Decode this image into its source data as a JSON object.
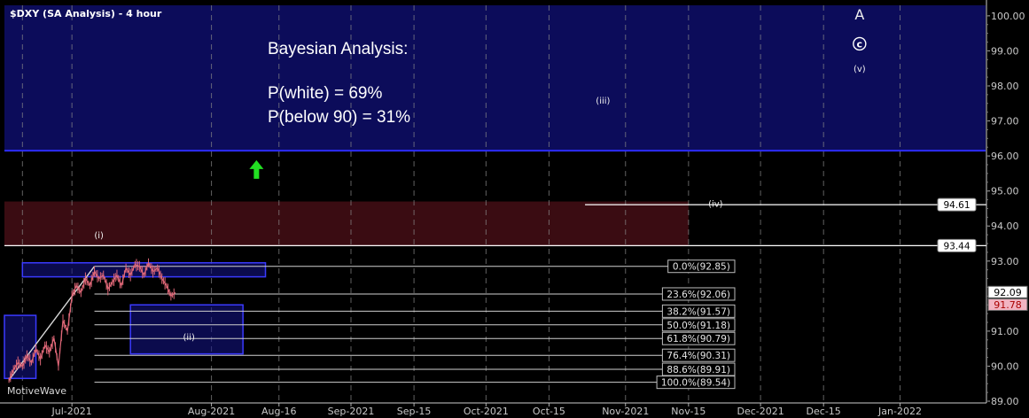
{
  "window": {
    "title": "$DXY (SA Analysis) - 4 hour",
    "watermark": "MotiveWave"
  },
  "annotation": {
    "heading": "Bayesian Analysis:",
    "line1": "P(white) = 69%",
    "line2": "P(below 90) = 31%"
  },
  "colors": {
    "background": "#000000",
    "blue_zone": "#0c0c5a",
    "red_zone": "#3a0c12",
    "grid": "#8a8a8a",
    "price": "#e06878",
    "white_line": "#ffffff",
    "box_border": "#3a3aff",
    "arrow": "#22e022"
  },
  "chart_data": {
    "type": "line",
    "symbol": "$DXY",
    "timeframe": "4 hour",
    "x_ticks": [
      "Jul-2021",
      "Aug-2021",
      "Aug-16",
      "Sep-2021",
      "Sep-15",
      "Oct-2021",
      "Oct-15",
      "Nov-2021",
      "Nov-15",
      "Dec-2021",
      "Dec-15",
      "Jan-2022"
    ],
    "y_ticks": [
      "100.00",
      "99.00",
      "98.00",
      "97.00",
      "96.00",
      "95.00",
      "94.00",
      "93.00",
      "91.00",
      "90.00",
      "89.00"
    ],
    "ylim": [
      88.95,
      100.3
    ],
    "price_series": [
      [
        "2021-06-17",
        89.6
      ],
      [
        "2021-06-18",
        89.9
      ],
      [
        "2021-06-19",
        90.1
      ],
      [
        "2021-06-20",
        90.0
      ],
      [
        "2021-06-21",
        90.3
      ],
      [
        "2021-06-22",
        90.1
      ],
      [
        "2021-06-23",
        90.5
      ],
      [
        "2021-06-24",
        90.2
      ],
      [
        "2021-06-25",
        90.6
      ],
      [
        "2021-06-26",
        90.4
      ],
      [
        "2021-06-27",
        90.8
      ],
      [
        "2021-06-28",
        90.0
      ],
      [
        "2021-06-29",
        91.3
      ],
      [
        "2021-06-30",
        91.0
      ],
      [
        "2021-07-01",
        92.0
      ],
      [
        "2021-07-02",
        92.3
      ],
      [
        "2021-07-03",
        92.1
      ],
      [
        "2021-07-04",
        92.5
      ],
      [
        "2021-07-05",
        92.3
      ],
      [
        "2021-07-06",
        92.7
      ],
      [
        "2021-07-07",
        92.5
      ],
      [
        "2021-07-08",
        92.6
      ],
      [
        "2021-07-09",
        92.2
      ],
      [
        "2021-07-10",
        92.4
      ],
      [
        "2021-07-11",
        92.6
      ],
      [
        "2021-07-12",
        92.3
      ],
      [
        "2021-07-13",
        92.8
      ],
      [
        "2021-07-14",
        92.6
      ],
      [
        "2021-07-15",
        92.9
      ],
      [
        "2021-07-16",
        92.85
      ],
      [
        "2021-07-17",
        92.6
      ],
      [
        "2021-07-18",
        92.95
      ],
      [
        "2021-07-19",
        92.7
      ],
      [
        "2021-07-20",
        92.8
      ],
      [
        "2021-07-21",
        92.5
      ],
      [
        "2021-07-22",
        92.3
      ],
      [
        "2021-07-23",
        92.0
      ],
      [
        "2021-07-24",
        92.1
      ]
    ],
    "wave_labels": [
      {
        "text": "A",
        "date": "2021-12-23",
        "y": 99.9
      },
      {
        "text": "c",
        "date": "2021-12-23",
        "y": 99.1
      },
      {
        "text": "(v)",
        "date": "2021-12-23",
        "y": 98.4
      },
      {
        "text": "(iii)",
        "date": "2021-10-27",
        "y": 97.5
      },
      {
        "text": "(iv)",
        "date": "2021-11-21",
        "y": 94.55
      },
      {
        "text": "(i)",
        "date": "2021-07-07",
        "y": 93.65
      },
      {
        "text": "(ii)",
        "date": "2021-07-27",
        "y": 90.75
      }
    ],
    "horizontal_lines": [
      {
        "value": 93.44,
        "label": "93.44",
        "from": "2021-06-16"
      },
      {
        "value": 94.61,
        "label": "94.61",
        "from": "2021-10-23"
      }
    ],
    "fib_levels": [
      {
        "label": "0.0%(92.85)",
        "value": 92.85
      },
      {
        "label": "23.6%(92.06)",
        "value": 92.06
      },
      {
        "label": "38.2%(91.57)",
        "value": 91.57
      },
      {
        "label": "50.0%(91.18)",
        "value": 91.18
      },
      {
        "label": "61.8%(90.79)",
        "value": 90.79
      },
      {
        "label": "76.4%(90.31)",
        "value": 90.31
      },
      {
        "label": "88.6%(89.91)",
        "value": 89.91
      },
      {
        "label": "100.0%(89.54)",
        "value": 89.54
      }
    ],
    "price_labels": [
      {
        "text": "92.09",
        "value": 92.09
      },
      {
        "text": "91.78",
        "value": 91.78
      }
    ],
    "zones": [
      {
        "kind": "blue",
        "y0": 96.15,
        "y1": 100.3,
        "x0": "2021-06-16",
        "x1": "2022-01-20"
      },
      {
        "kind": "red",
        "y0": 93.45,
        "y1": 94.7,
        "x0": "2021-06-16",
        "x1": "2021-11-15"
      }
    ],
    "boxes": [
      {
        "y0": 92.55,
        "y1": 92.95,
        "x0": "2021-06-20",
        "x1": "2021-08-13"
      },
      {
        "y0": 90.35,
        "y1": 91.75,
        "x0": "2021-07-14",
        "x1": "2021-08-08"
      },
      {
        "y0": 89.65,
        "y1": 91.45,
        "x0": "2021-06-16",
        "x1": "2021-06-23"
      }
    ],
    "trend_line": [
      [
        "2021-06-17",
        89.6
      ],
      [
        "2021-07-06",
        92.85
      ]
    ],
    "arrow": {
      "date": "2021-08-11",
      "y": 95.6,
      "direction": "up"
    }
  }
}
